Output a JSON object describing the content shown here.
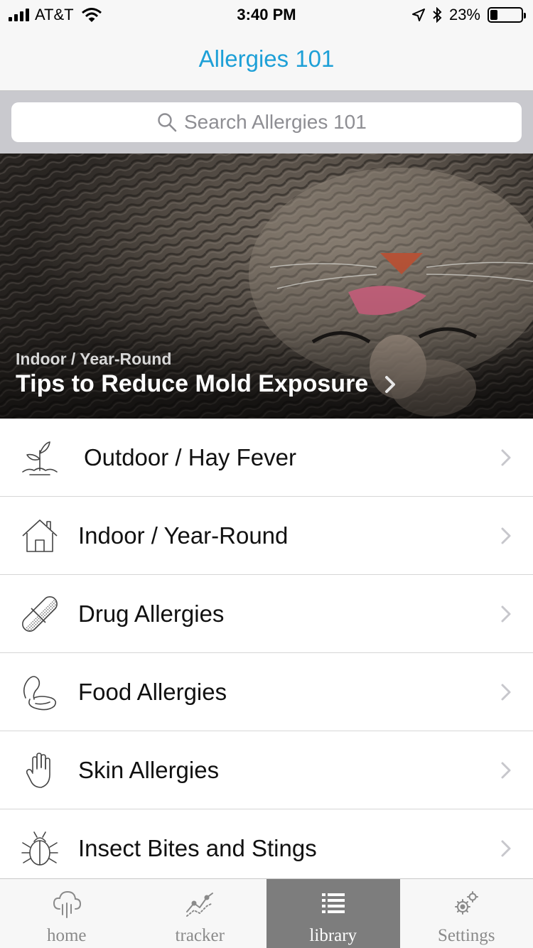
{
  "status_bar": {
    "carrier": "AT&T",
    "time": "3:40 PM",
    "battery_percent": "23%",
    "battery_level": 0.23,
    "icons": [
      "signal-icon",
      "wifi-icon",
      "location-arrow-icon",
      "bluetooth-icon",
      "battery-icon"
    ]
  },
  "nav": {
    "title": "Allergies 101",
    "title_color": "#1ea0d7"
  },
  "search": {
    "placeholder": "Search Allergies 101",
    "value": ""
  },
  "hero": {
    "kicker": "Indoor / Year-Round",
    "title": "Tips to Reduce Mold Exposure"
  },
  "categories": [
    {
      "label": "Outdoor / Hay Fever",
      "icon": "sprout-icon"
    },
    {
      "label": "Indoor / Year-Round",
      "icon": "house-icon"
    },
    {
      "label": "Drug Allergies",
      "icon": "pill-icon"
    },
    {
      "label": "Food Allergies",
      "icon": "peanut-icon"
    },
    {
      "label": "Skin Allergies",
      "icon": "hand-icon"
    },
    {
      "label": "Insect Bites and Stings",
      "icon": "beetle-icon"
    }
  ],
  "tabs": [
    {
      "label": "home",
      "icon": "cloud-rain-icon",
      "active": false
    },
    {
      "label": "tracker",
      "icon": "trend-chart-icon",
      "active": false
    },
    {
      "label": "library",
      "icon": "list-icon",
      "active": true
    },
    {
      "label": "Settings",
      "icon": "gears-icon",
      "active": false
    }
  ]
}
